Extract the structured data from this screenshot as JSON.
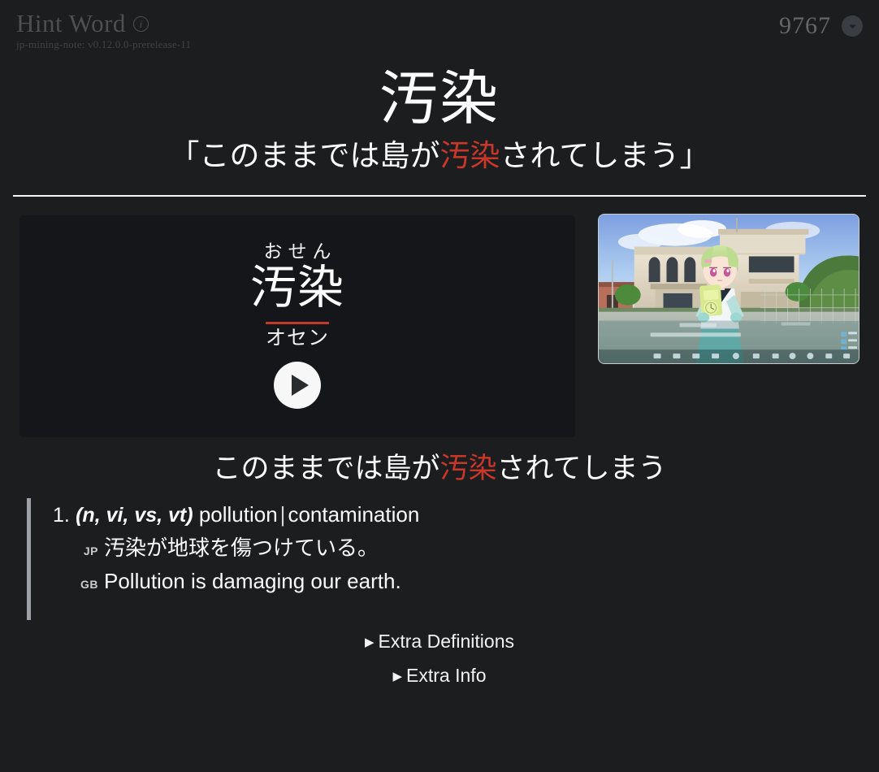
{
  "header": {
    "hint_word_label": "Hint Word",
    "info_icon": "info-icon",
    "version": "jp-mining-note: v0.12.0.0-prerelease-11",
    "card_count": "9767",
    "chevron_icon": "chevron-down-icon"
  },
  "word": {
    "main_word": "汚染",
    "sentence_open_quote": "「",
    "sentence_before": "このままでは島が",
    "sentence_highlight": "汚染",
    "sentence_after": "されてしまう",
    "sentence_close_quote": "」"
  },
  "card": {
    "furigana": "おせん",
    "kanji": "汚染",
    "katakana": "オセン",
    "pitch_accent_color": "#c0392b",
    "play_button_label": "play-audio"
  },
  "picture": {
    "alt": "visual novel screenshot: green-haired girl in school uniform holding a device in front of a school building"
  },
  "sub_sentence": {
    "before": "このままでは島が",
    "highlight": "汚染",
    "after": "されてしまう"
  },
  "definitions": [
    {
      "number": "1.",
      "pos": "(n, vi, vs, vt)",
      "glosses": [
        "pollution",
        "contamination"
      ],
      "separator": "|",
      "examples": [
        {
          "lang": "JP",
          "text": "汚染が地球を傷つけている。"
        },
        {
          "lang": "GB",
          "text": "Pollution is damaging our earth."
        }
      ]
    }
  ],
  "disclosures": [
    {
      "triangle": "▶",
      "label": "Extra Definitions"
    },
    {
      "triangle": "▶",
      "label": "Extra Info"
    }
  ],
  "colors": {
    "background": "#1b1d1f",
    "card_background": "#141619",
    "highlight_red": "#c9372a",
    "divider": "#f4f4f4",
    "muted_text": "#4c4f53"
  }
}
